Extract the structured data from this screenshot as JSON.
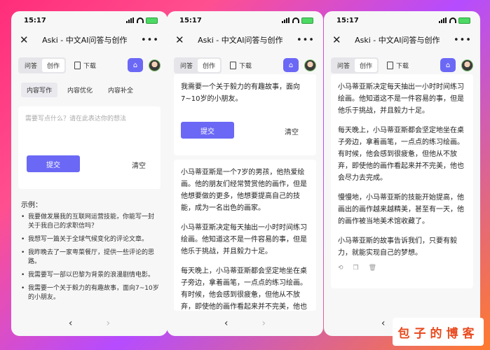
{
  "status": {
    "time": "15:17"
  },
  "app": {
    "title": "Aski - 中文AI问答与创作",
    "more": "•••",
    "close": "✕"
  },
  "toolbar": {
    "tab_qa": "问答",
    "tab_create": "创作",
    "download": "下载"
  },
  "nav": {
    "back": "‹",
    "forward": "›"
  },
  "screen1": {
    "tabs": [
      "内容写作",
      "内容优化",
      "内容补全"
    ],
    "placeholder": "需要写点什么？请在此表达你的想法",
    "submit": "提交",
    "clear": "清空",
    "examples_title": "示例：",
    "examples": [
      "我要做发展我的互联网运营技能，你能写一封关于我自己的求职信吗？",
      "我想写一篇关于全球气候变化的评论文章。",
      "我昨晚去了一家粤菜餐厅，提供一些评论的思路。",
      "我需要写一部以巴黎为背景的浪漫剧情电影。",
      "我需要一个关于毅力的有趣故事，面向7~10岁的小朋友。"
    ]
  },
  "screen2": {
    "prompt": "我需要一个关于毅力的有趣故事，面向7~10岁的小朋友。",
    "submit": "提交",
    "clear": "清空",
    "paragraphs": [
      "小马蒂亚斯是一个7岁的男孩，他热爱绘画。他的朋友们经常赞赏他的画作，但是他想要做的更多，他想要提高自己的技能，成为一名出色的画家。",
      "小马蒂亚斯决定每天抽出一小时时间练习绘画。他知道这不是一件容易的事，但是他乐于挑战，并且毅力十足。",
      "每天晚上，小马蒂亚斯都会坚定地坐在桌子旁边，拿着画笔，一点点的练习绘画。有时候，他会感到很疲惫，但他从不放弃，即使他的画作看起来并不完美，他也"
    ]
  },
  "screen3": {
    "paragraphs": [
      "小马蒂亚斯决定每天抽出一小时时间练习绘画。他知道这不是一件容易的事，但是他乐于挑战，并且毅力十足。",
      "每天晚上，小马蒂亚斯都会坚定地坐在桌子旁边，拿着画笔，一点点的练习绘画。有时候，他会感到很疲惫，但他从不放弃，即使他的画作看起来并不完美，他也会尽力去完成。",
      "慢慢地，小马蒂亚斯的技能开始提高，他画出的画作越来越精美，甚至有一天，他的画作被当地美术馆收藏了。",
      "小马蒂亚斯的故事告诉我们，只要有毅力，就能实现自己的梦想。"
    ],
    "actions": [
      "⟲",
      "❐",
      "🗑"
    ]
  },
  "watermark": "包子的博客"
}
